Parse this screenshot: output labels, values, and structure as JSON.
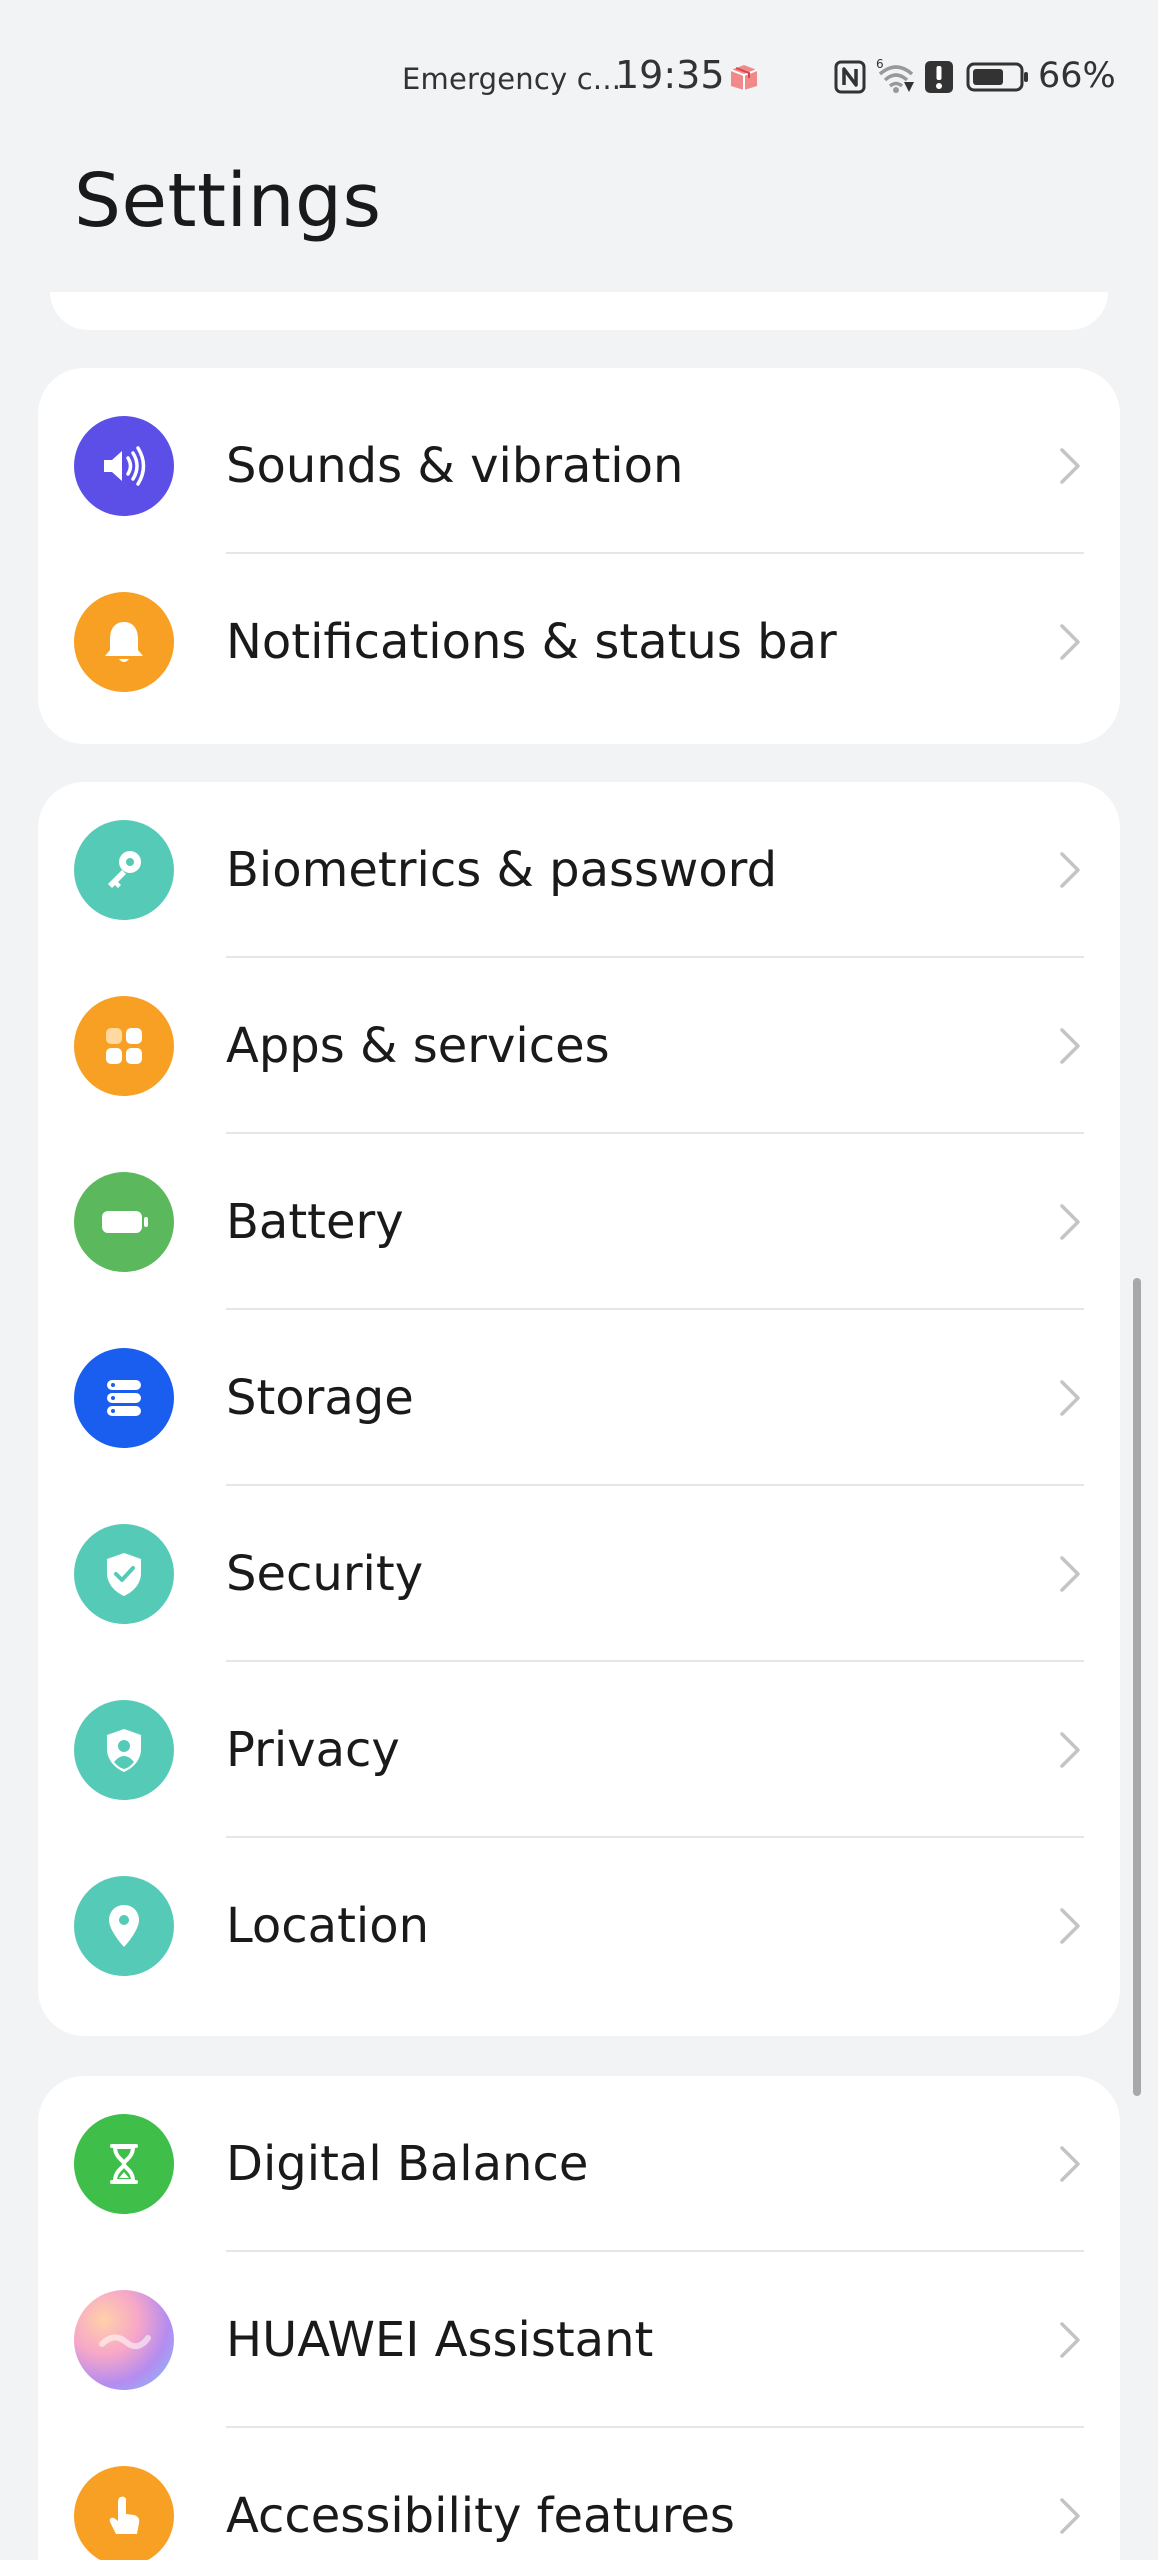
{
  "status_bar": {
    "carrier_text": "Emergency c...",
    "time": "19:35",
    "battery_percent": "66%",
    "icons": [
      "package-icon",
      "nfc-icon",
      "wifi-icon",
      "alert-icon",
      "battery-icon"
    ]
  },
  "header": {
    "title": "Settings"
  },
  "groups": [
    {
      "items": [
        {
          "label": "Sounds & vibration",
          "icon": "sound-icon",
          "color": "#5b4fe8"
        },
        {
          "label": "Notifications & status bar",
          "icon": "bell-icon",
          "color": "#f8a023"
        }
      ]
    },
    {
      "items": [
        {
          "label": "Biometrics & password",
          "icon": "key-icon",
          "color": "#55cbb7"
        },
        {
          "label": "Apps & services",
          "icon": "apps-icon",
          "color": "#f8a023"
        },
        {
          "label": "Battery",
          "icon": "battery-icon",
          "color": "#5cb85c"
        },
        {
          "label": "Storage",
          "icon": "storage-icon",
          "color": "#1a5ef0"
        },
        {
          "label": "Security",
          "icon": "shield-check-icon",
          "color": "#55cbb7"
        },
        {
          "label": "Privacy",
          "icon": "privacy-icon",
          "color": "#55cbb7"
        },
        {
          "label": "Location",
          "icon": "location-pin-icon",
          "color": "#55cbb7"
        }
      ]
    },
    {
      "items": [
        {
          "label": "Digital Balance",
          "icon": "hourglass-icon",
          "color": "#3fbe4a"
        },
        {
          "label": "HUAWEI Assistant",
          "icon": "assistant-icon",
          "color": "#c58cf0"
        },
        {
          "label": "Accessibility features",
          "icon": "hand-icon",
          "color": "#f8a023"
        }
      ]
    }
  ]
}
